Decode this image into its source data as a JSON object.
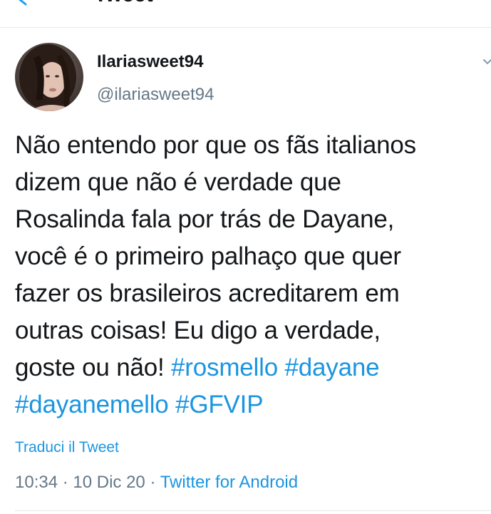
{
  "appbar": {
    "title": "Tweet"
  },
  "author": {
    "display_name": "Ilariasweet94",
    "handle": "@ilariasweet94"
  },
  "tweet": {
    "lines": [
      "Não entendo por que os fãs italianos",
      "dizem que não é verdade que",
      "Rosalinda fala por trás de Dayane,",
      "você é o primeiro palhaço que quer",
      "fazer os brasileiros acreditarem em",
      "outras coisas! Eu digo a verdade,"
    ],
    "line7_text": "goste ou não! ",
    "hashtags": [
      "#rosmello",
      "#dayane",
      "#dayanemello",
      "#GFVIP"
    ]
  },
  "translate_label": "Traduci il Tweet",
  "meta": {
    "time": "10:34",
    "separator": " · ",
    "date": "10 Dic 20",
    "source": "Twitter for Android"
  },
  "colors": {
    "text": "#14171a",
    "secondary": "#657786",
    "link": "#1b95e0",
    "divider": "#e1e8ed"
  },
  "icons": {
    "back": "back-arrow-icon",
    "caret": "chevron-down-icon"
  }
}
